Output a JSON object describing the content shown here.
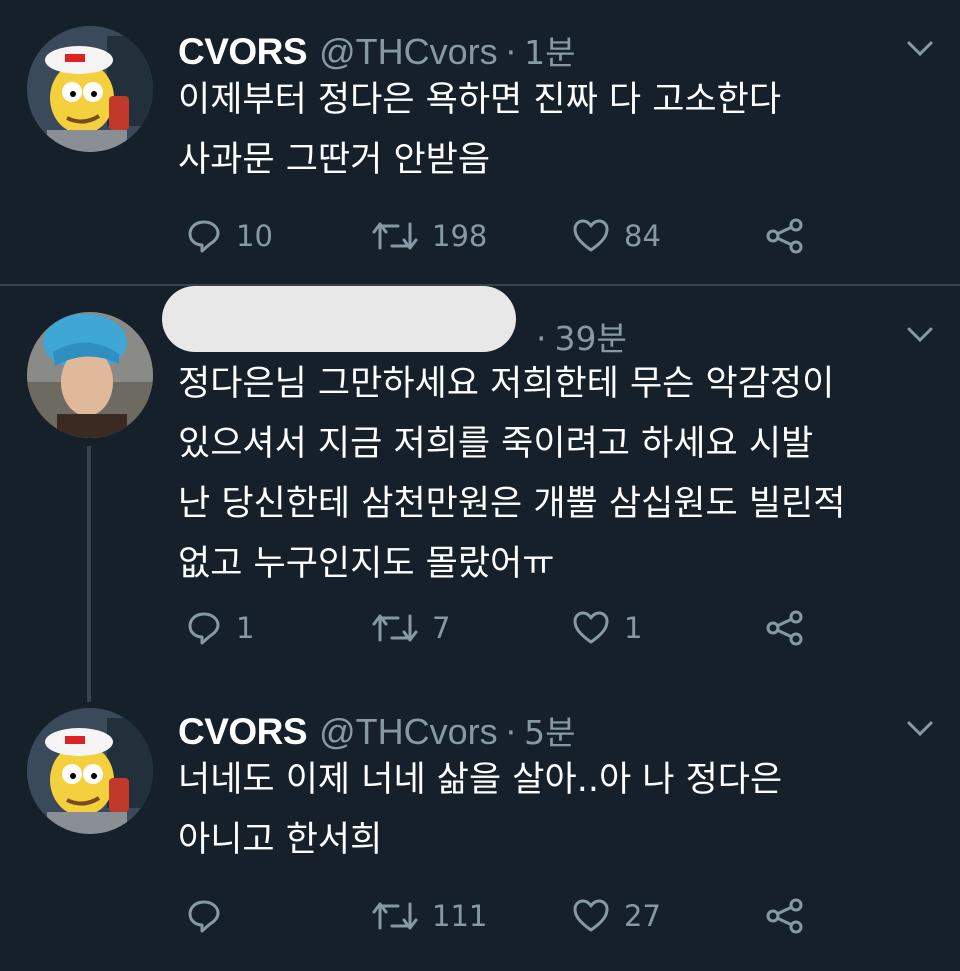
{
  "tweets": [
    {
      "name": "CVORS",
      "handle": "@THCvors",
      "dot": "·",
      "time": "1분",
      "lines": [
        "이제부터 정다은 욕하면 진짜 다 고소한다",
        "사과문 그딴거 안받음"
      ],
      "reply_count": "10",
      "retweet_count": "198",
      "like_count": "84"
    },
    {
      "name": "",
      "handle": "",
      "dot": "·",
      "time": "39분",
      "lines": [
        "정다은님 그만하세요 저희한테 무슨 악감정이",
        "있으셔서 지금 저희를 죽이려고 하세요 시발",
        "난 당신한테 삼천만원은 개뿔 삼십원도 빌린적",
        "없고 누구인지도 몰랐어ㅠ"
      ],
      "reply_count": "1",
      "retweet_count": "7",
      "like_count": "1"
    },
    {
      "name": "CVORS",
      "handle": "@THCvors",
      "dot": "·",
      "time": "5분",
      "lines": [
        "너네도 이제 너네 삶을 살아..아 나 정다은",
        "아니고 한서희"
      ],
      "reply_count": "",
      "retweet_count": "111",
      "like_count": "27"
    }
  ],
  "colors": {
    "background": "#15202b",
    "secondary_text": "#8899a6",
    "divider": "#38444d"
  },
  "icons": [
    "reply-icon",
    "retweet-icon",
    "like-icon",
    "share-icon",
    "chevron-down-icon"
  ]
}
